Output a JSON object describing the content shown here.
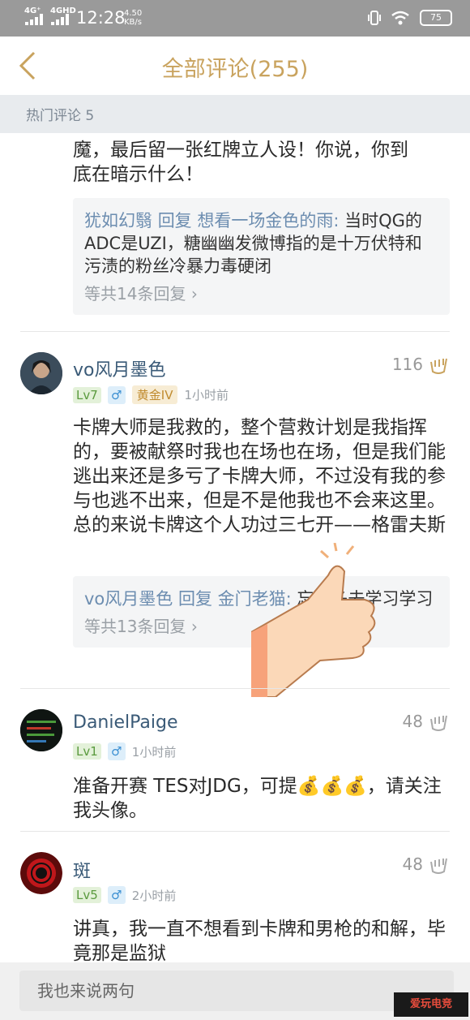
{
  "status_bar": {
    "net1": "4G⁺",
    "net2": "4GHD",
    "time": "12:28",
    "speed_value": "4.50",
    "speed_unit": "KB/s",
    "battery": "75"
  },
  "header": {
    "title": "全部评论(255)"
  },
  "section": {
    "label": "热门评论 5"
  },
  "comments": [
    {
      "text_lines": [
        "魔，最后留一张红牌立人设！你说，你到",
        "底在暗示什么！"
      ],
      "reply": {
        "user": "犹如幻翳",
        "verb": "回复",
        "target": "想看一场金色的雨:",
        "text": " 当时QG的ADC是UZI，糖幽幽发微博指的是十万伏特和污渍的粉丝冷暴力毒硬闭",
        "more": "等共14条回复"
      }
    },
    {
      "username": "vo风月墨色",
      "level": "Lv7",
      "gender": "♂",
      "rank": "黄金IV",
      "time": "1小时前",
      "likes": "116",
      "text": "卡牌大师是我救的，整个营救计划是我指挥的，要被献祭时我也在场也在场，但是我们能逃出来还是多亏了卡牌大师，不过没有我的参与也逃不出来，但是不是他我也不会来这里。总的来说卡牌这个人功过三七开——格雷夫斯",
      "reply": {
        "user": "vo风月墨色",
        "verb": "回复",
        "target": "金门老猫:",
        "text": " 忘了多去学习学习",
        "more": "等共13条回复"
      }
    },
    {
      "username": "DanielPaige",
      "level": "Lv1",
      "gender": "♂",
      "time": "1小时前",
      "likes": "48",
      "text": "准备开赛 TES对JDG，可提💰💰💰，请关注我头像。"
    },
    {
      "username": "斑",
      "level": "Lv5",
      "gender": "♂",
      "time": "2小时前",
      "likes": "48",
      "text": "讲真，我一直不想看到卡牌和男枪的和解，毕竟那是监狱"
    }
  ],
  "input": {
    "placeholder": "我也来说两句"
  },
  "watermark": {
    "text": "爱玩电竞"
  },
  "colors": {
    "accent": "#c9a35e",
    "username": "#3a5a77",
    "reply_user": "#6c8db0"
  }
}
